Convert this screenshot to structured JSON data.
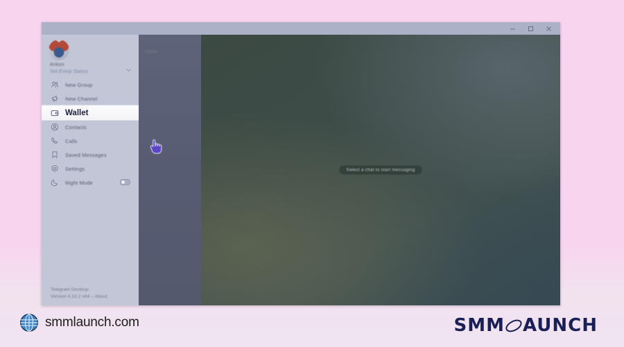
{
  "page": {
    "background_color": "#f8d4ef",
    "background_color_bottom": "#efe4f0"
  },
  "window": {
    "app_name": "Telegram Desktop",
    "titlebar": {
      "minimize_label": "Minimize",
      "maximize_label": "Maximize",
      "close_label": "Close"
    }
  },
  "sidebar": {
    "profile": {
      "name": "Ankon",
      "status": "Set Emoji Status",
      "expand_label": "Expand account menu"
    },
    "items": [
      {
        "label": "New Group",
        "icon": "people-icon",
        "active": false
      },
      {
        "label": "New Channel",
        "icon": "megaphone-icon",
        "active": false
      },
      {
        "label": "Wallet",
        "icon": "wallet-icon",
        "active": true
      },
      {
        "label": "Contacts",
        "icon": "contact-icon",
        "active": false
      },
      {
        "label": "Calls",
        "icon": "phone-icon",
        "active": false
      },
      {
        "label": "Saved Messages",
        "icon": "bookmark-icon",
        "active": false
      },
      {
        "label": "Settings",
        "icon": "gear-icon",
        "active": false
      },
      {
        "label": "Night Mode",
        "icon": "moon-icon",
        "active": false,
        "toggle": "off"
      }
    ],
    "footer": {
      "product": "Telegram Desktop",
      "version": "Version 4.10.2 x64 – About"
    },
    "highlight_color": "#fbfbfd",
    "background_color": "#c2c6d6"
  },
  "chat_list": {
    "placeholder_text": "Search",
    "background_color": "#5a5f75"
  },
  "chat_area": {
    "empty_state": "Select a chat to start messaging",
    "background_color": "#3e4c48"
  },
  "cursor": {
    "type": "pointing-hand",
    "color": "#5b45c9"
  },
  "branding": {
    "site": "smmlaunch.com",
    "logo_text_left": "SMM",
    "logo_text_right": "AUNCH",
    "logo_color": "#1a1f55",
    "globe_icon": "globe-icon"
  }
}
